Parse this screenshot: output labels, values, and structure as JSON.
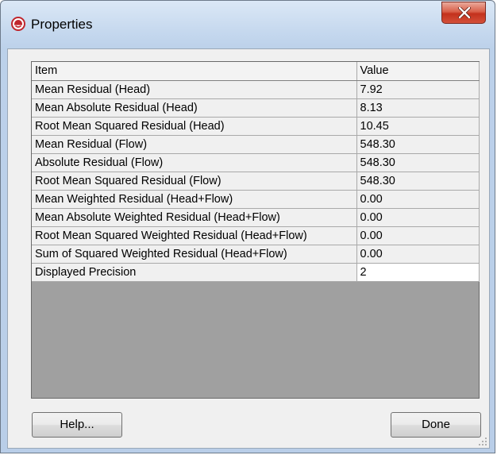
{
  "window": {
    "title": "Properties",
    "icon": "properties-app-icon",
    "close_icon": "close-x-icon"
  },
  "table": {
    "headers": {
      "item": "Item",
      "value": "Value"
    },
    "rows": [
      {
        "item": "Mean Residual (Head)",
        "value": "7.92"
      },
      {
        "item": "Mean Absolute Residual (Head)",
        "value": "8.13"
      },
      {
        "item": "Root Mean Squared Residual (Head)",
        "value": "10.45"
      },
      {
        "item": "Mean Residual (Flow)",
        "value": "548.30"
      },
      {
        "item": "Absolute Residual (Flow)",
        "value": "548.30"
      },
      {
        "item": "Root Mean Squared Residual (Flow)",
        "value": "548.30"
      },
      {
        "item": "Mean Weighted Residual (Head+Flow)",
        "value": "0.00"
      },
      {
        "item": "Mean Absolute Weighted Residual (Head+Flow)",
        "value": "0.00"
      },
      {
        "item": "Root Mean Squared Weighted Residual (Head+Flow)",
        "value": "0.00"
      },
      {
        "item": "Sum of Squared Weighted Residual (Head+Flow)",
        "value": "0.00"
      },
      {
        "item": "Displayed Precision",
        "value": "2"
      }
    ]
  },
  "buttons": {
    "help": "Help...",
    "done": "Done"
  },
  "colors": {
    "title_gradient": "#c5d8ee",
    "close_button": "#c3311c",
    "client_bg": "#f0f0f0",
    "grid_empty_bg": "#a0a0a0"
  }
}
